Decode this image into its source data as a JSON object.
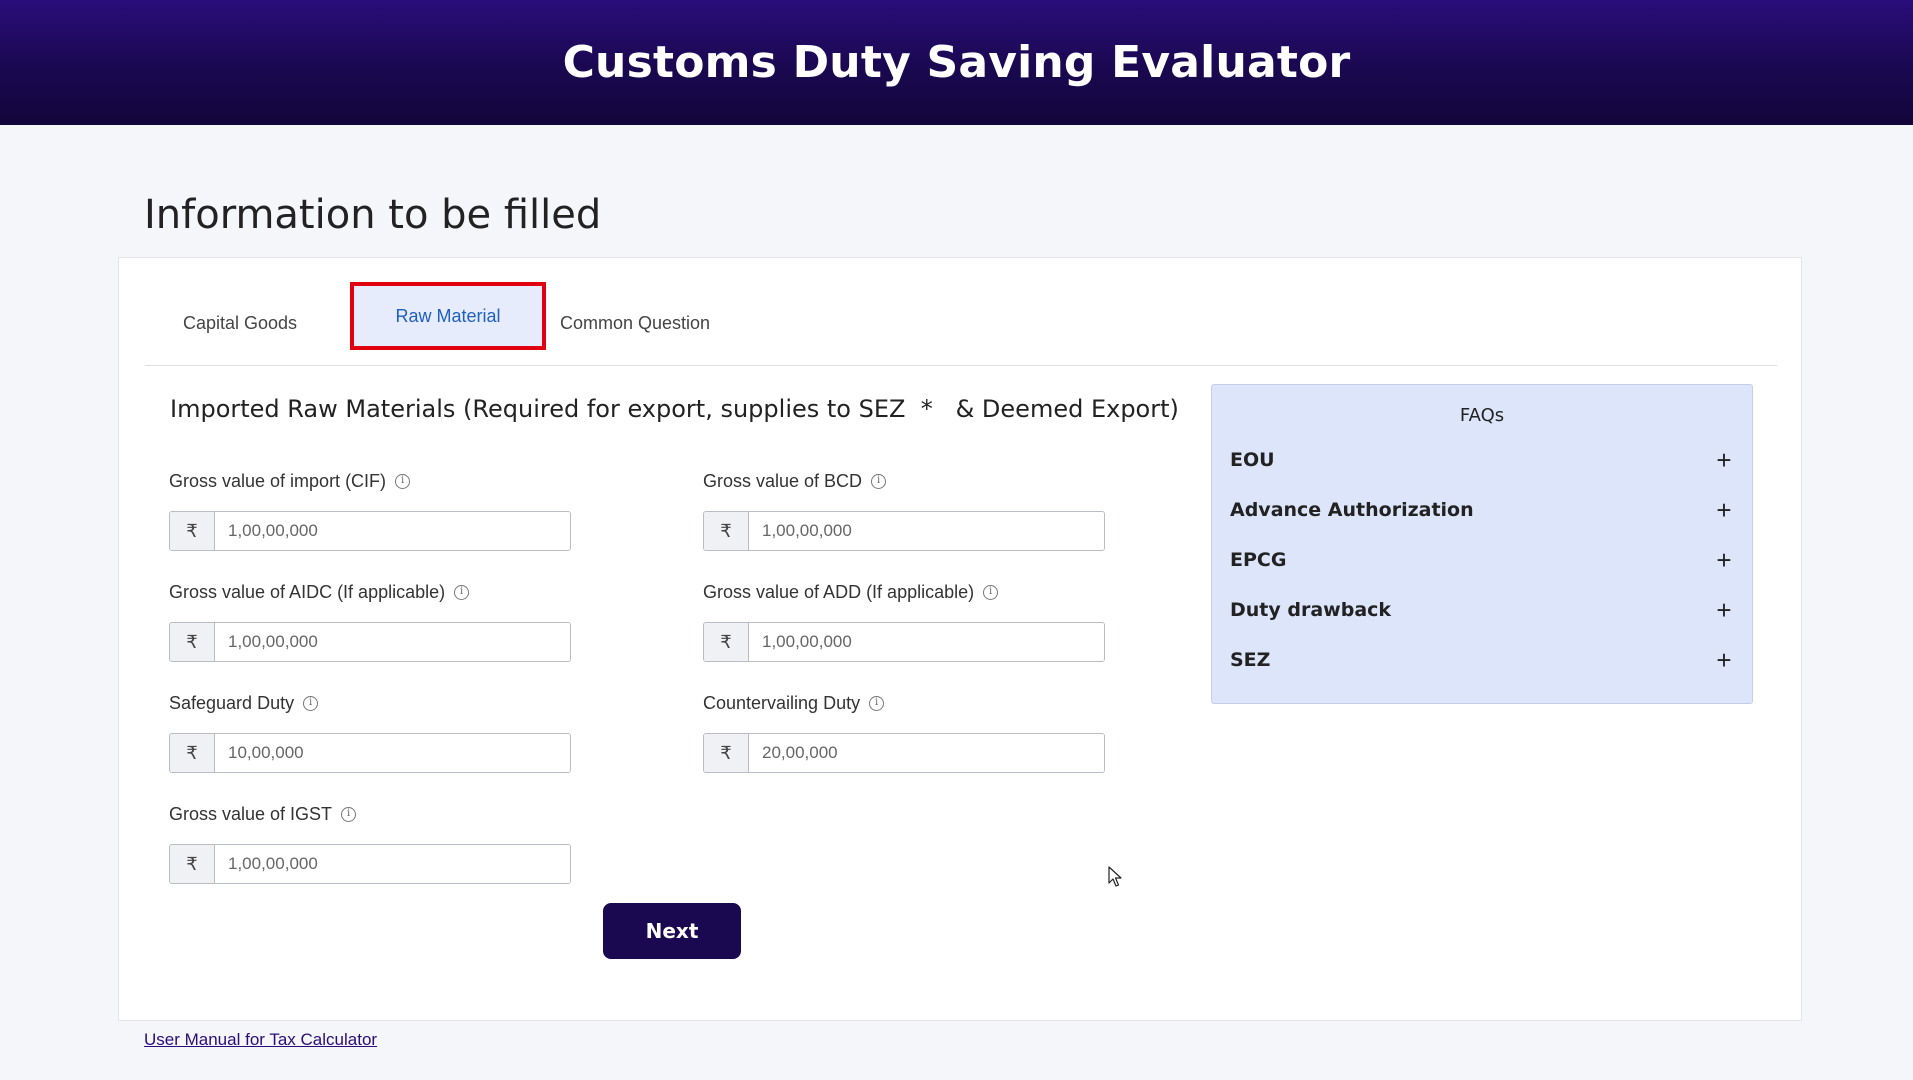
{
  "header": {
    "title": "Customs Duty Saving Evaluator"
  },
  "section": {
    "title": "Information to be filled"
  },
  "tabs": [
    {
      "label": "Capital Goods"
    },
    {
      "label": "Raw Material"
    },
    {
      "label": "Common Question"
    }
  ],
  "form": {
    "heading": "Imported Raw Materials (Required for export, supplies to SEZ  *   & Deemed Export)",
    "currency_symbol": "₹",
    "fields": [
      {
        "label": "Gross value of import (CIF)",
        "placeholder": "1,00,00,000"
      },
      {
        "label": "Gross value of BCD",
        "placeholder": "1,00,00,000"
      },
      {
        "label": "Gross value of AIDC (If applicable)",
        "placeholder": "1,00,00,000"
      },
      {
        "label": "Gross value of ADD (If applicable)",
        "placeholder": "1,00,00,000"
      },
      {
        "label": "Safeguard Duty",
        "placeholder": "10,00,000"
      },
      {
        "label": "Countervailing Duty",
        "placeholder": "20,00,000"
      },
      {
        "label": "Gross value of IGST",
        "placeholder": "1,00,00,000"
      }
    ],
    "next_label": "Next"
  },
  "faq": {
    "title": "FAQs",
    "items": [
      {
        "label": "EOU"
      },
      {
        "label": "Advance Authorization"
      },
      {
        "label": "EPCG"
      },
      {
        "label": "Duty drawback"
      },
      {
        "label": "SEZ"
      }
    ],
    "expand_symbol": "+"
  },
  "footer": {
    "manual_link": "User Manual for Tax Calculator"
  },
  "colors": {
    "header_bg": "#1a0850",
    "active_tab_bg": "#e6ecfb",
    "active_tab_text": "#1f5fbf",
    "highlight_border": "#e10010",
    "faq_bg": "#dde5fb",
    "button_bg": "#1a0850"
  }
}
